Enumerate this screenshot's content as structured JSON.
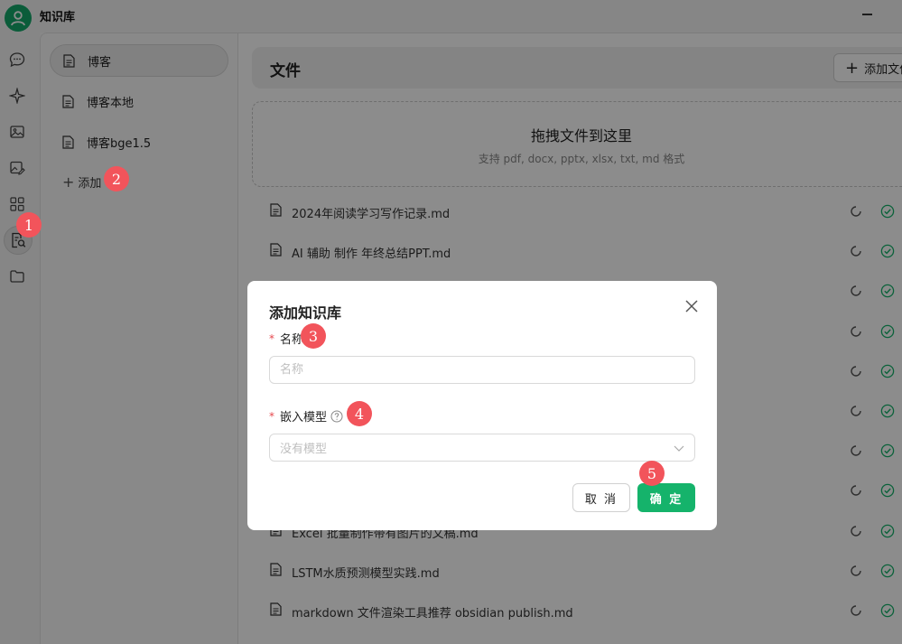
{
  "app": {
    "title": "知识库"
  },
  "rail": [
    {
      "name": "chat-icon",
      "active": false
    },
    {
      "name": "sparkle-icon",
      "active": false
    },
    {
      "name": "image-icon",
      "active": false
    },
    {
      "name": "image-edit-icon",
      "active": false
    },
    {
      "name": "grid-apps-icon",
      "active": false
    },
    {
      "name": "knowledge-base-icon",
      "active": true
    },
    {
      "name": "folder-icon",
      "active": false
    }
  ],
  "kb": {
    "items": [
      {
        "label": "博客",
        "selected": true
      },
      {
        "label": "博客本地",
        "selected": false
      },
      {
        "label": "博客bge1.5",
        "selected": false
      }
    ],
    "add_label": "添加"
  },
  "files": {
    "title": "文件",
    "add_button": "添加文件",
    "dropzone": {
      "title": "拖拽文件到这里",
      "subtitle": "支持 pdf, docx, pptx, xlsx, txt, md 格式"
    },
    "rows": [
      "2024年阅读学习写作记录.md",
      "AI 辅助 制作 年终总结PPT.md",
      "",
      "",
      "",
      "",
      "",
      "",
      "Excel 批量制作带有图片的文稿.md",
      "LSTM水质预测模型实践.md",
      "markdown 文件渲染工具推荐 obsidian publish.md"
    ]
  },
  "modal": {
    "title": "添加知识库",
    "name_label": "名称",
    "name_placeholder": "名称",
    "model_label": "嵌入模型",
    "model_placeholder": "没有模型",
    "cancel": "取 消",
    "confirm": "确 定"
  },
  "badges": [
    "1",
    "2",
    "3",
    "4",
    "5"
  ],
  "colors": {
    "accent": "#15b36b",
    "badge": "#f2545b",
    "required": "#e5484d"
  }
}
